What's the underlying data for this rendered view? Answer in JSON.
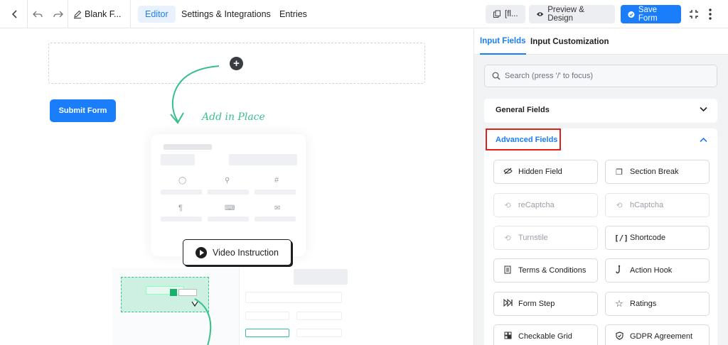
{
  "topbar": {
    "title": "Blank F...",
    "tabs": [
      "Editor",
      "Settings & Integrations",
      "Entries"
    ],
    "shortcode_label": "[fl...",
    "preview_label": "Preview & Design",
    "save_label": "Save Form"
  },
  "canvas": {
    "submit_label": "Submit Form",
    "hint_text": "Add in Place",
    "video_label": "Video Instruction"
  },
  "panel": {
    "tabs": [
      "Input Fields",
      "Input Customization"
    ],
    "search_placeholder": "Search (press '/' to focus)",
    "general_title": "General Fields",
    "advanced_title": "Advanced Fields",
    "fields": [
      {
        "label": "Hidden Field",
        "icon": "eye-off-icon",
        "disabled": false
      },
      {
        "label": "Section Break",
        "icon": "puzzle-icon",
        "disabled": false
      },
      {
        "label": "reCaptcha",
        "icon": "recaptcha-icon",
        "disabled": true
      },
      {
        "label": "hCaptcha",
        "icon": "hcaptcha-icon",
        "disabled": true
      },
      {
        "label": "Turnstile",
        "icon": "turnstile-icon",
        "disabled": true
      },
      {
        "label": "Shortcode",
        "icon": "shortcode-icon",
        "disabled": false
      },
      {
        "label": "Terms & Conditions",
        "icon": "document-icon",
        "disabled": false
      },
      {
        "label": "Action Hook",
        "icon": "hook-icon",
        "disabled": false
      },
      {
        "label": "Form Step",
        "icon": "steps-icon",
        "disabled": false
      },
      {
        "label": "Ratings",
        "icon": "star-icon",
        "disabled": false
      },
      {
        "label": "Checkable Grid",
        "icon": "grid-icon",
        "disabled": false
      },
      {
        "label": "GDPR Agreement",
        "icon": "shield-icon",
        "disabled": false
      }
    ]
  },
  "colors": {
    "accent": "#1a7efb",
    "highlight": "#e0201a",
    "hint_green": "#38c08b"
  }
}
